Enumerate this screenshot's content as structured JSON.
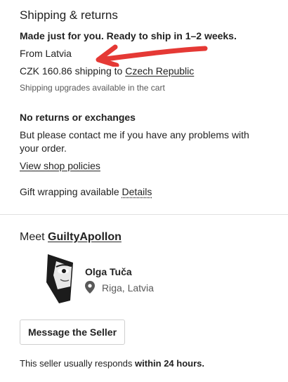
{
  "shipping": {
    "title": "Shipping & returns",
    "ready_text": "Made just for you. Ready to ship in 1–2 weeks.",
    "origin": "From Latvia",
    "cost_prefix": "CZK 160.86 shipping to ",
    "destination": "Czech Republic",
    "upgrade_note": "Shipping upgrades available in the cart"
  },
  "returns": {
    "title": "No returns or exchanges",
    "contact_line1": "But please contact me if you have any problems with",
    "contact_line2": "your order.",
    "policies_link": "View shop policies",
    "gift_prefix": "Gift wrapping available ",
    "gift_link": "Details"
  },
  "seller": {
    "meet_prefix": "Meet ",
    "shop_name": "GuiltyApollon",
    "name": "Olga Tuča",
    "location": "Riga, Latvia",
    "message_button": "Message the Seller",
    "response_prefix": "This seller usually responds ",
    "response_time": "within 24 hours."
  },
  "annotation": {
    "color": "#e53935"
  },
  "icons": {
    "location": "location-pin-icon",
    "arrow": "red-arrow-annotation"
  }
}
